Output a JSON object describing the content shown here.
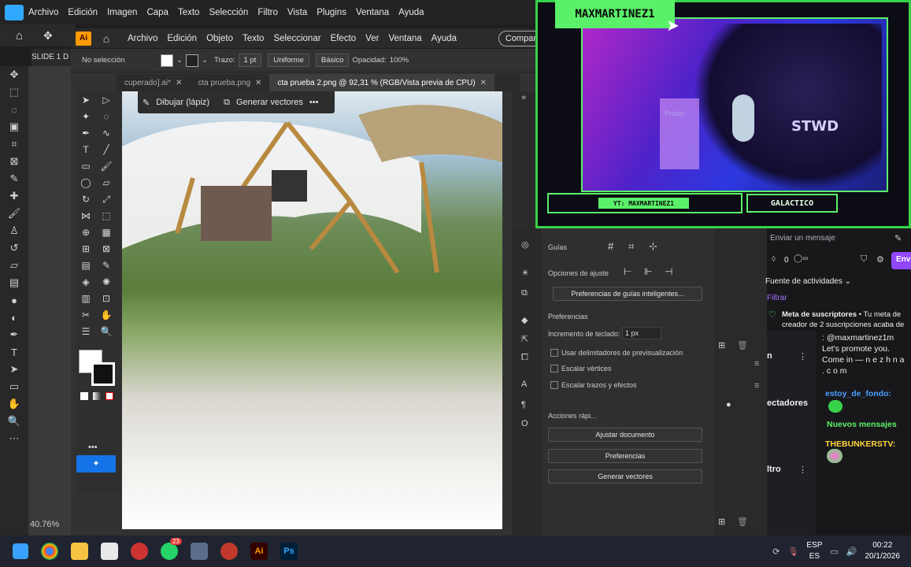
{
  "ps": {
    "menu": [
      "Archivo",
      "Edición",
      "Imagen",
      "Capa",
      "Texto",
      "Selección",
      "Filtro",
      "Vista",
      "Plugins",
      "Ventana",
      "Ayuda"
    ],
    "slide_tab": "SLIDE 1 D",
    "zoom": "40.76%"
  },
  "ai": {
    "logo": "Ai",
    "menu": [
      "Archivo",
      "Edición",
      "Objeto",
      "Texto",
      "Seleccionar",
      "Efecto",
      "Ver",
      "Ventana",
      "Ayuda"
    ],
    "share": "Compar",
    "ctrl": {
      "selection": "No selección",
      "stroke_label": "Trazo:",
      "stroke_value": "1 pt",
      "uniform": "Uniforme",
      "basic": "Básico",
      "opacity_label": "Opacidad:",
      "opacity_value": "100%"
    },
    "tabs": [
      {
        "label": "cuperado].ai*"
      },
      {
        "label": "cta prueba.png"
      },
      {
        "label": "cta prueba 2.png @ 92,31 % (RGB/Vista previa de CPU)"
      }
    ],
    "context_bar": {
      "draw": "Dibujar (lápiz)",
      "vectorize": "Generar vectores"
    },
    "panel": {
      "guides": "Guías",
      "snap_options": "Opciones de ajuste",
      "smart_guides_prefs": "Preferencias de guías inteligentes...",
      "preferences": "Preferencias",
      "keyboard_increment": "Incremento de teclado:",
      "keyboard_value": "1 px",
      "chk1": "Usar delimitadores de previsualización",
      "chk2": "Escalar vértices",
      "chk3": "Escalar trazos y efectos",
      "quick_actions": "Acciones rápi...",
      "btn_fit": "Ajustar documento",
      "btn_prefs": "Preferencias",
      "btn_vectors": "Generar vectores"
    },
    "side_labels": {
      "a": "n",
      "b": "ectadores",
      "c": "ltro"
    }
  },
  "stream": {
    "name": "MAXMARTINEZ1",
    "yt": "YT: MAXMARTINEZ1",
    "tag": "GALACTICO",
    "cam_brand": "Protec",
    "shirt": "STWD"
  },
  "chat": {
    "send_placeholder": "Enviar un mensaje",
    "counter": "0",
    "send_btn": "Envi",
    "feed": "Fuente de actividades",
    "filter": "Filtrar",
    "goal_title": "Meta de suscriptores",
    "goal_text": "• Tu meta de creador de 2 suscripciones acaba de",
    "msg1": ": @maxmartinez1m Let's promote you. Come in — n e z h n a . c o m",
    "user2": "estoy_de_fondo:",
    "new_msgs": "Nuevos mensajes",
    "user3": "THEBUNKERSTV:"
  },
  "taskbar": {
    "lang1": "ESP",
    "lang2": "ES",
    "time": "00:22",
    "date": "20/1/2026",
    "badge": "23"
  },
  "colors": {
    "neon_green": "#5bf06a",
    "ai_orange": "#ff9a00",
    "ps_blue": "#31a8ff",
    "twitch_purple": "#9147ff"
  }
}
